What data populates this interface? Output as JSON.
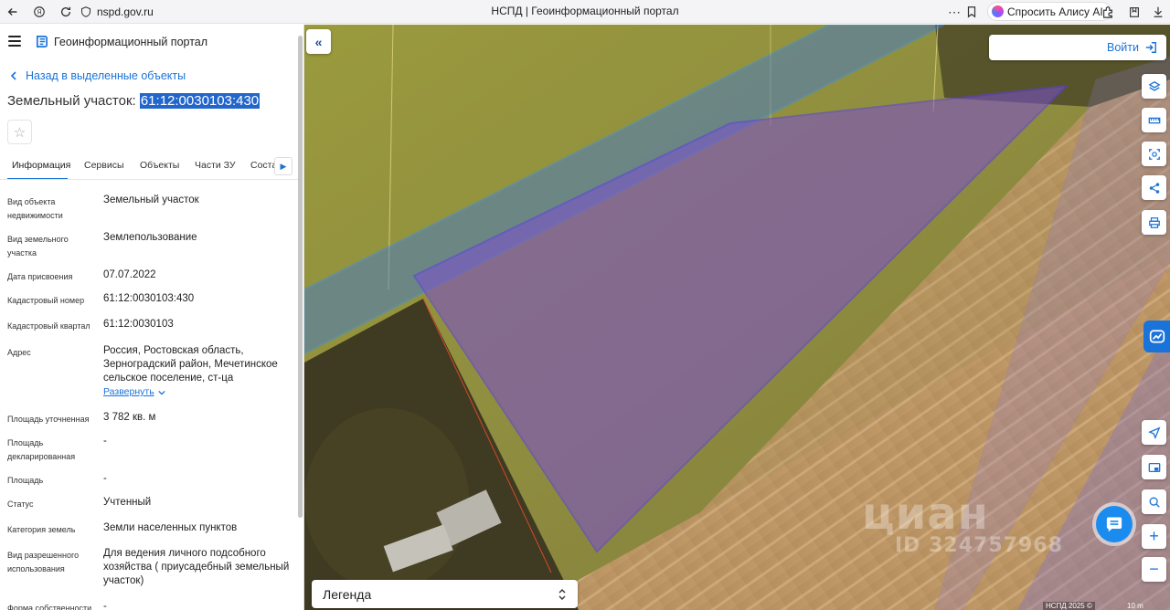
{
  "browser": {
    "url": "nspd.gov.ru",
    "tab_title": "НСПД | Геоинформационный портал",
    "alice_label": "Спросить Алису AI"
  },
  "app": {
    "portal_title": "Геоинформационный портал",
    "back_link": "Назад в выделенные объекты",
    "object_title_prefix": "Земельный участок: ",
    "object_title_number": "61:12:0030103:430"
  },
  "tabs": [
    "Информация",
    "Сервисы",
    "Объекты",
    "Части ЗУ",
    "Соста"
  ],
  "details": [
    {
      "label": "Вид объекта недвижимости",
      "value": "Земельный участок"
    },
    {
      "label": "Вид земельного участка",
      "value": "Землепользование"
    },
    {
      "label": "Дата присвоения",
      "value": "07.07.2022"
    },
    {
      "label": "Кадастровый номер",
      "value": "61:12:0030103:430"
    },
    {
      "label": "Кадастровый квартал",
      "value": "61:12:0030103"
    },
    {
      "label": "Адрес",
      "value": "Россия, Ростовская область, Зерноградский район, Мечетинское сельское поселение, ст-ца"
    },
    {
      "label": "Площадь уточненная",
      "value": "3 782 кв. м"
    },
    {
      "label": "Площадь декларированная",
      "value": "-"
    },
    {
      "label": "Площадь",
      "value": "-"
    },
    {
      "label": "Статус",
      "value": "Учтенный"
    },
    {
      "label": "Категория земель",
      "value": "Земли населенных пунктов"
    },
    {
      "label": "Вид разрешенного использования",
      "value": "Для ведения личного подсобного хозяйства ( приусадебный земельный участок)"
    },
    {
      "label": "Форма собственности",
      "value": "-"
    }
  ],
  "expand_label": "Развернуть",
  "map": {
    "login_label": "Войти",
    "legend_label": "Легенда",
    "watermark_main": "циан",
    "watermark_id": "ID 324757968",
    "attribution": "НСПД 2025 ©",
    "scale_label": "10 m"
  },
  "icons": {
    "back": "arrow-left-icon",
    "forward": "arrow-right-icon",
    "refresh": "refresh-icon",
    "login": "login-icon",
    "layers": "layers-icon",
    "ruler": "ruler-icon",
    "select": "select-area-icon",
    "share": "share-icon",
    "print": "print-icon",
    "locate": "navigation-icon",
    "minimap": "minimap-icon",
    "search-location": "search-location-icon"
  },
  "colors": {
    "accent": "#1a73d9",
    "parcel_fill": "#7b4fd0",
    "strip_fill": "#3d78d8"
  }
}
